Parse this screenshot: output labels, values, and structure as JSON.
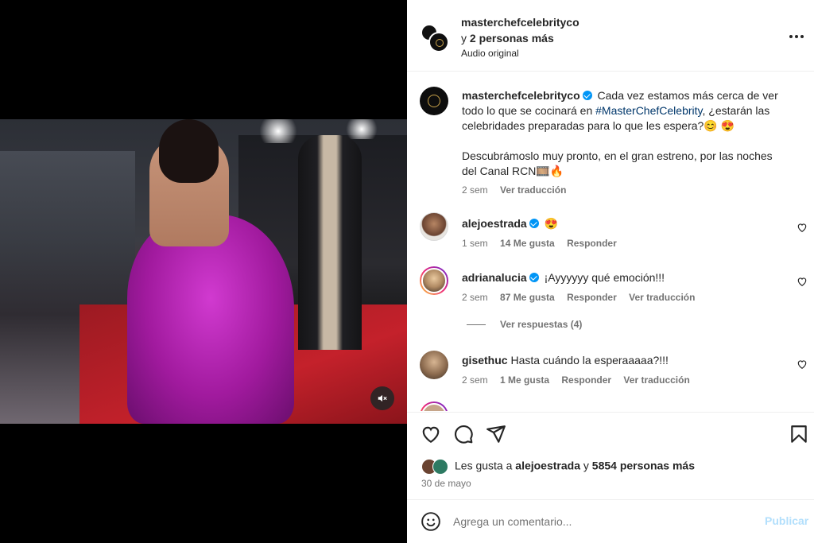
{
  "header": {
    "username": "masterchefcelebrityco",
    "and_prefix": "y",
    "and_others": "2 personas más",
    "audio": "Audio original"
  },
  "caption": {
    "username": "masterchefcelebrityco",
    "text_1": " Cada vez estamos más cerca de ver todo lo que se cocinará en ",
    "hashtag": "#MasterChefCelebrity",
    "text_2": ", ¿estarán las celebridades preparadas para lo que les espera?😊 😍",
    "text_3": "Descubrámoslo muy pronto, en el gran estreno, por las noches del Canal RCN🎞️🔥",
    "time": "2 sem",
    "translate": "Ver traducción"
  },
  "comments": [
    {
      "username": "alejoestrada",
      "verified": true,
      "text": "😍",
      "time": "1 sem",
      "likes": "14 Me gusta",
      "reply": "Responder",
      "translate": ""
    },
    {
      "username": "adrianalucia",
      "verified": true,
      "text": "¡Ayyyyyy qué emoción!!!",
      "time": "2 sem",
      "likes": "87 Me gusta",
      "reply": "Responder",
      "translate": "Ver traducción"
    },
    {
      "username": "gisethuc",
      "verified": false,
      "text": "Hasta cuándo la esperaaaaa?!!!",
      "time": "2 sem",
      "likes": "1 Me gusta",
      "reply": "Responder",
      "translate": "Ver traducción"
    }
  ],
  "view_replies": "Ver respuestas (4)",
  "likes": {
    "prefix": "Les gusta a",
    "user": "alejoestrada",
    "joiner": "y",
    "others": "5854 personas más"
  },
  "date": "30 de mayo",
  "composer": {
    "placeholder": "Agrega un comentario...",
    "post": "Publicar"
  },
  "colors": {
    "accent": "#0095f6",
    "post_disabled": "#b2dffc",
    "hashtag": "#00376b",
    "muted": "#737373"
  },
  "icons": [
    "more-icon",
    "mute-icon",
    "heart-icon",
    "comment-icon",
    "share-icon",
    "bookmark-icon",
    "emoji-icon",
    "verified-icon"
  ]
}
